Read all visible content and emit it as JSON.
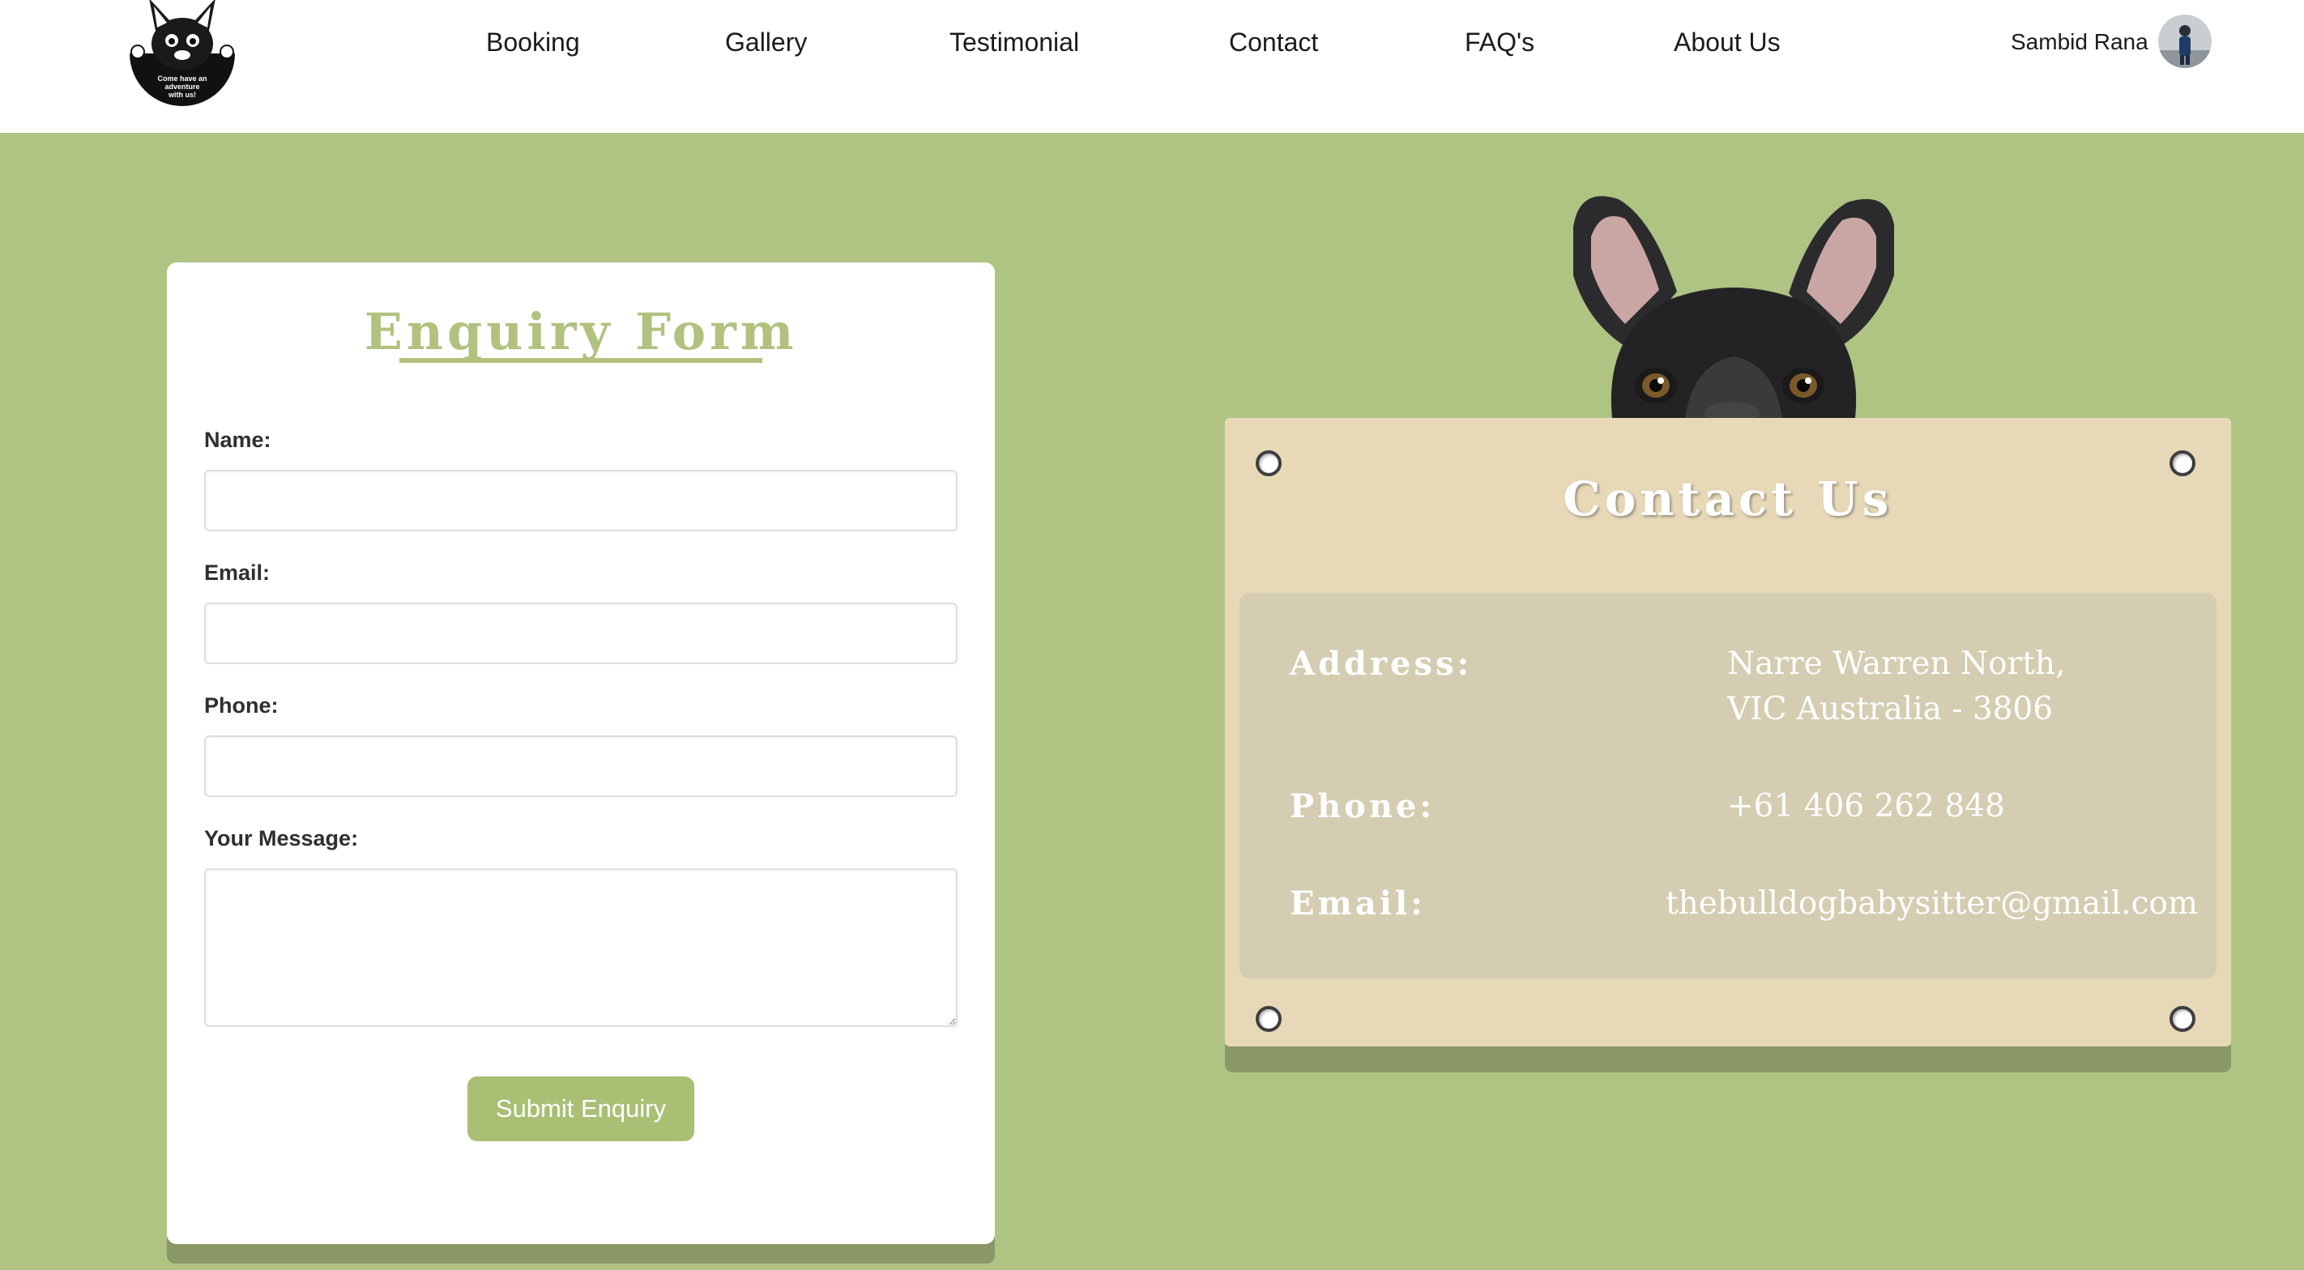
{
  "header": {
    "logo_text": "Come have an adventure with us!",
    "nav": [
      {
        "label": "Booking"
      },
      {
        "label": "Gallery"
      },
      {
        "label": "Testimonial"
      },
      {
        "label": "Contact"
      },
      {
        "label": "FAQ's"
      },
      {
        "label": "About Us"
      }
    ],
    "user_name": "Sambid Rana"
  },
  "enquiry": {
    "title": "Enquiry Form",
    "fields": {
      "name": {
        "label": "Name:",
        "value": ""
      },
      "email": {
        "label": "Email:",
        "value": ""
      },
      "phone": {
        "label": "Phone:",
        "value": ""
      },
      "message": {
        "label": "Your Message:",
        "value": ""
      }
    },
    "submit_label": "Submit Enquiry"
  },
  "contact": {
    "title": "Contact Us",
    "address_label": "Address:",
    "address_line1": "Narre Warren North,",
    "address_line2": "VIC Australia - 3806",
    "phone_label": "Phone:",
    "phone_value": "+61 406 262 848",
    "email_label": "Email:",
    "email_value": "thebulldogbabysitter@gmail.com"
  },
  "colors": {
    "page_background": "#afc382",
    "accent_green": "#a9bf74",
    "plaque": "#e7d9b8",
    "plaque_inner": "#d4cdb2"
  }
}
